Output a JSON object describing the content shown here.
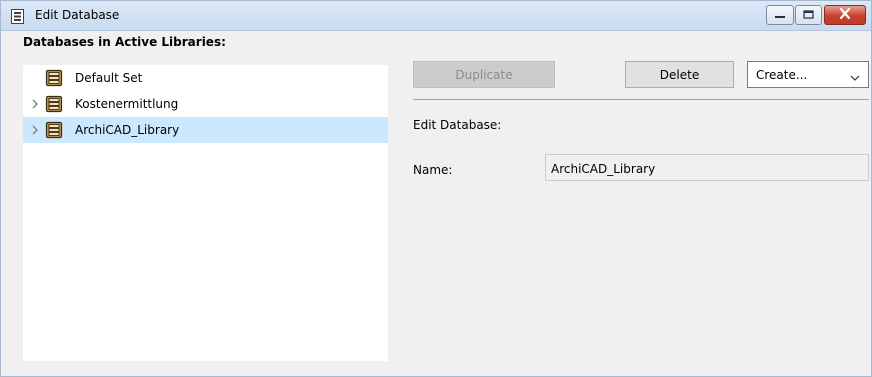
{
  "window": {
    "title": "Edit Database",
    "title_icon": "database-document-icon",
    "controls": [
      "minimize-icon",
      "maximize-icon",
      "close-icon"
    ]
  },
  "left_panel": {
    "label": "Databases in Active Libraries:",
    "items": [
      {
        "label": "Default Set",
        "icon": "database-cabinet-icon",
        "expandable": false,
        "selected": false
      },
      {
        "label": "Kostenermittlung",
        "icon": "database-cabinet-icon",
        "expandable": true,
        "selected": false
      },
      {
        "label": "ArchiCAD_Library",
        "icon": "database-cabinet-icon",
        "expandable": true,
        "selected": true
      }
    ]
  },
  "toolbar": {
    "duplicate_label": "Duplicate",
    "duplicate_enabled": false,
    "delete_label": "Delete",
    "create_select_value": "Create..."
  },
  "details": {
    "section_label": "Edit Database:",
    "name_label": "Name:",
    "name_value": "ArchiCAD_Library"
  },
  "colors": {
    "selection": "#cce8ff",
    "window_bg": "#f0f0f0",
    "close_button": "#c0392b",
    "cabinet_icon": "#8a5a1e"
  }
}
